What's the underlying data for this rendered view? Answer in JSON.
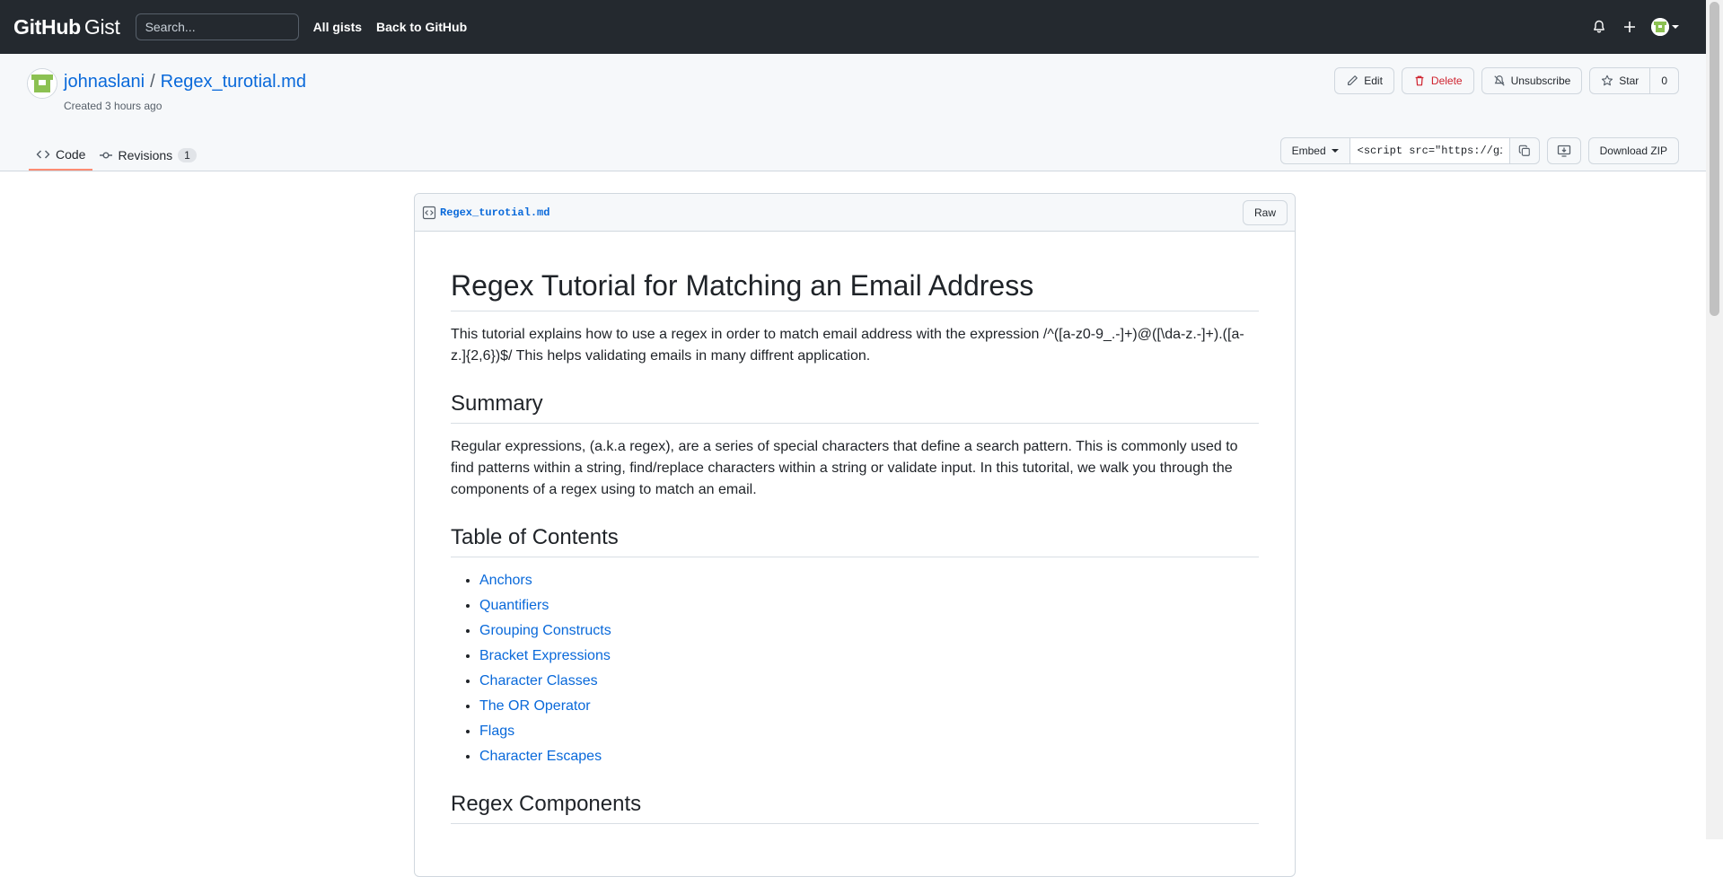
{
  "header": {
    "brand_github": "GitHub",
    "brand_gist": "Gist",
    "search_placeholder": "Search...",
    "links": [
      "All gists",
      "Back to GitHub"
    ]
  },
  "gist": {
    "owner": "johnaslani",
    "separator": "/",
    "filename": "Regex_turotial.md",
    "created": "Created 3 hours ago",
    "actions": {
      "edit": "Edit",
      "delete": "Delete",
      "unsubscribe": "Unsubscribe",
      "star": "Star",
      "star_count": "0"
    },
    "tabs": {
      "code": "Code",
      "revisions": "Revisions",
      "revisions_count": "1"
    },
    "embed": {
      "label": "Embed",
      "value": "<script src=\"https://gist.github.com/johnaslani/",
      "download": "Download ZIP"
    }
  },
  "file": {
    "name": "Regex_turotial.md",
    "raw_label": "Raw"
  },
  "markdown": {
    "title": "Regex Tutorial for Matching an Email Address",
    "intro": "This tutorial explains how to use a regex in order to match email address with the expression /^([a-z0-9_.-]+)@([\\da-z.-]+).([a-z.]{2,6})$/ This helps validating emails in many diffrent application.",
    "summary_heading": "Summary",
    "summary_text": "Regular expressions, (a.k.a regex), are a series of special characters that define a search pattern. This is commonly used to find patterns within a string, find/replace characters within a string or validate input. In this tutorital, we walk you through the components of a regex using to match an email.",
    "toc_heading": "Table of Contents",
    "toc": [
      "Anchors",
      "Quantifiers",
      "Grouping Constructs",
      "Bracket Expressions",
      "Character Classes",
      "The OR Operator",
      "Flags",
      "Character Escapes"
    ],
    "components_heading": "Regex Components"
  },
  "colors": {
    "header_bg": "#24292f",
    "link": "#0969da",
    "tab_underline": "#fd8c73",
    "danger": "#cf222e"
  }
}
